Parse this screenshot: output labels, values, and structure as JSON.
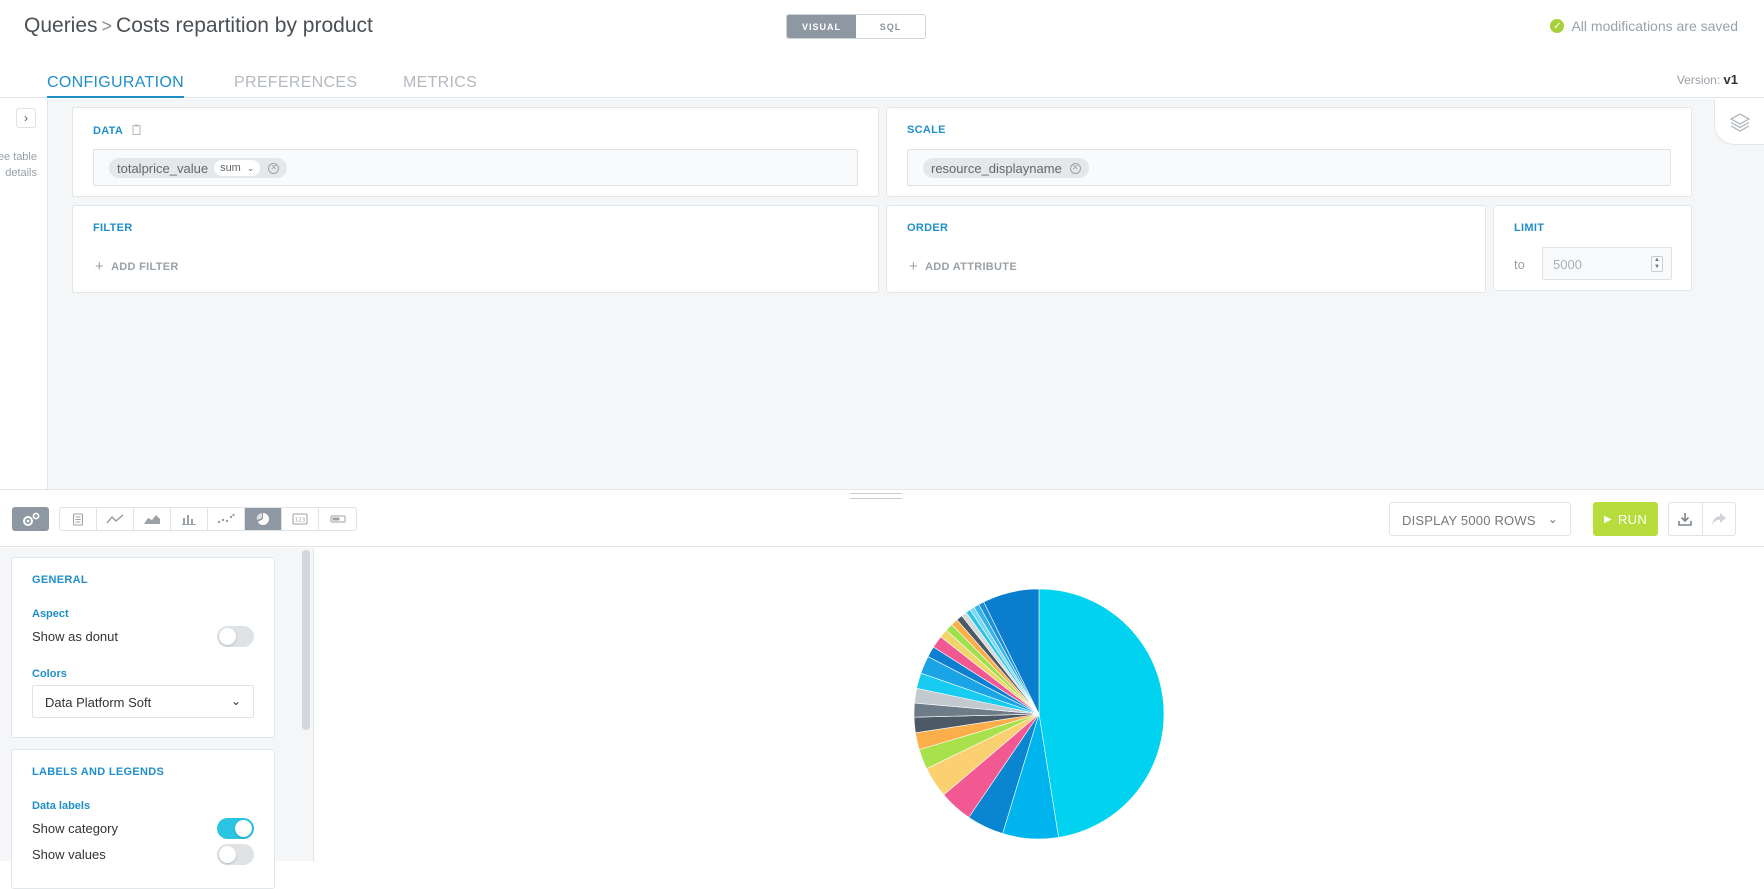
{
  "header": {
    "breadcrumb_root": "Queries",
    "breadcrumb_sep": ">",
    "title": "Costs repartition by product",
    "mode_visual": "VISUAL",
    "mode_sql": "SQL",
    "saved_status": "All modifications are saved"
  },
  "tabs": {
    "configuration": "CONFIGURATION",
    "preferences": "PREFERENCES",
    "metrics": "METRICS",
    "version_label": "Version:",
    "version_value": "v1"
  },
  "rail": {
    "text_line1": "ee table",
    "text_line2": "details"
  },
  "panels": {
    "data": {
      "title": "DATA",
      "field": "totalprice_value",
      "aggregation": "sum"
    },
    "scale": {
      "title": "SCALE",
      "field": "resource_displayname"
    },
    "filter": {
      "title": "FILTER",
      "add_label": "ADD FILTER"
    },
    "order": {
      "title": "ORDER",
      "add_label": "ADD ATTRIBUTE"
    },
    "limit": {
      "title": "LIMIT",
      "to_label": "to",
      "placeholder": "5000"
    }
  },
  "toolbar": {
    "rows_select": "DISPLAY 5000 ROWS",
    "run_label": "RUN",
    "active_chart_type": "pie",
    "chart_type_icons": [
      "table-icon",
      "line-chart-icon",
      "area-chart-icon",
      "bar-chart-icon",
      "scatter-chart-icon",
      "pie-chart-icon",
      "number-icon",
      "gauge-icon"
    ]
  },
  "settings": {
    "general": {
      "title": "GENERAL",
      "aspect_label": "Aspect",
      "show_as_donut": "Show as donut",
      "show_as_donut_on": false,
      "colors_label": "Colors",
      "colors_value": "Data Platform Soft"
    },
    "labels": {
      "title": "LABELS AND LEGENDS",
      "data_labels": "Data labels",
      "show_category": "Show category",
      "show_category_on": true,
      "show_values": "Show values",
      "show_values_on": false
    }
  },
  "colors": {
    "accent": "#1f8fc9",
    "run": "#b7dd3c",
    "toggle_on": "#2bc4e3"
  },
  "chart_data": {
    "type": "pie",
    "values": [
      47.5,
      7.2,
      4.8,
      4.3,
      4.0,
      2.6,
      2.2,
      2.0,
      1.8,
      1.9,
      2.0,
      2.3,
      1.4,
      1.6,
      1.1,
      1.0,
      0.9,
      0.8,
      0.7,
      0.6,
      0.6,
      0.7,
      0.7,
      7.3
    ],
    "colors": [
      "#00d2f0",
      "#00b4ee",
      "#0a85cf",
      "#f25992",
      "#fbd070",
      "#a8e14c",
      "#fcae4a",
      "#4e5966",
      "#6e7c8a",
      "#c2c9cf",
      "#17ccf0",
      "#1aa4e6",
      "#0d7fd1",
      "#f25992",
      "#f0d56a",
      "#9fe04d",
      "#fcae4a",
      "#4e5966",
      "#d3d9dd",
      "#2bc4e3",
      "#7dd6ef",
      "#36b3e8",
      "#1c8fd6",
      "#0a7dcc"
    ]
  }
}
